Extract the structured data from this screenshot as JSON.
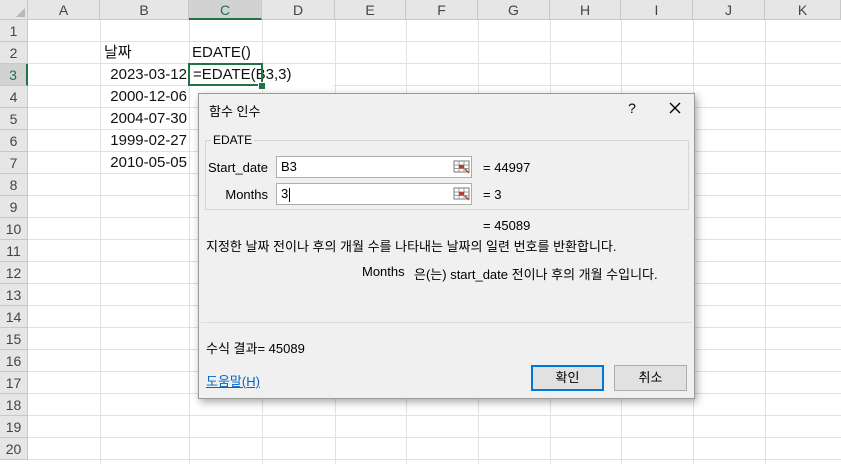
{
  "spreadsheet": {
    "columns": [
      "A",
      "B",
      "C",
      "D",
      "E",
      "F",
      "G",
      "H",
      "I",
      "J",
      "K"
    ],
    "selected_column": "C",
    "rows": [
      "1",
      "2",
      "3",
      "4",
      "5",
      "6",
      "7",
      "8",
      "9",
      "10",
      "11",
      "12",
      "13",
      "14",
      "15",
      "16",
      "17",
      "18",
      "19",
      "20"
    ],
    "selected_row": "3",
    "cells": {
      "B2": "날짜",
      "C2": "EDATE()",
      "B3": "2023-03-12",
      "C3": "=EDATE(B3,3)",
      "B4": "2000-12-06",
      "B5": "2004-07-30",
      "B6": "1999-02-27",
      "B7": "2010-05-05"
    }
  },
  "dialog": {
    "title": "함수 인수",
    "help_glyph": "?",
    "function_name": "EDATE",
    "args": [
      {
        "label": "Start_date",
        "value": "B3",
        "result": "=  44997"
      },
      {
        "label": "Months",
        "value": "3",
        "result": "=  3"
      }
    ],
    "function_result": "=  45089",
    "description": "지정한 날짜 전이나 후의 개월 수를 나타내는 날짜의 일련 번호를 반환합니다.",
    "arg_description_name": "Months",
    "arg_description_text": "은(는) start_date 전이나 후의 개월 수입니다.",
    "formula_result": "수식 결과=  45089",
    "help_link": "도움말(H)",
    "ok_label": "확인",
    "cancel_label": "취소"
  },
  "colors": {
    "accent": "#217346",
    "button_focus": "#0078d7",
    "link": "#0066cc"
  }
}
